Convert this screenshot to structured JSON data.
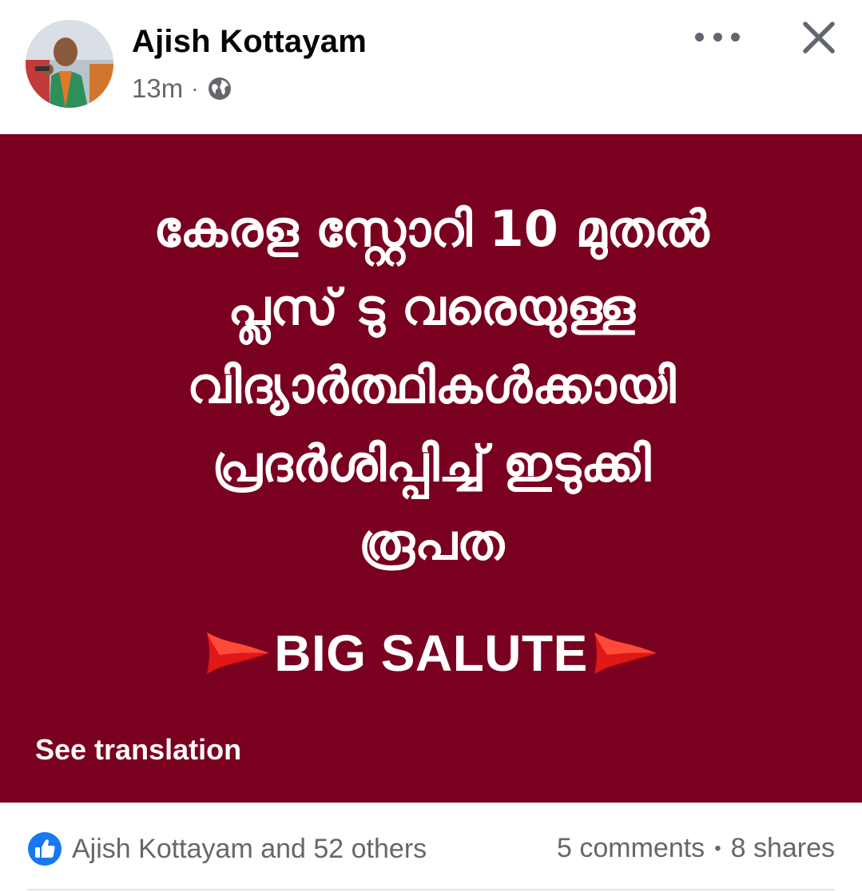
{
  "post": {
    "author_name": "Ajish Kottayam",
    "time": "13m",
    "separator": "·",
    "privacy_icon": "globe-icon",
    "menu_icon": "more-options-icon",
    "close_icon": "close-icon"
  },
  "card": {
    "background_color": "#7a0020",
    "headline_lines": [
      "കേരള സ്റ്റോറി 10 മുതൽ",
      "പ്ലസ് ടു വരെയുള്ള",
      "വിദ്യാർത്ഥികൾക്കായി",
      "പ്രദർശിപ്പിച്ച് ഇടുക്കി",
      "രൂപത"
    ],
    "salute_text": "BIG SALUTE",
    "flag_icon": "red-flag-icon",
    "see_translation": "See translation"
  },
  "footer": {
    "like_icon": "like-thumb-icon",
    "reactions_text": "Ajish Kottayam and 52 others",
    "comments": "5 comments",
    "dot": "•",
    "shares": "8 shares",
    "accent_color": "#1877f2"
  }
}
